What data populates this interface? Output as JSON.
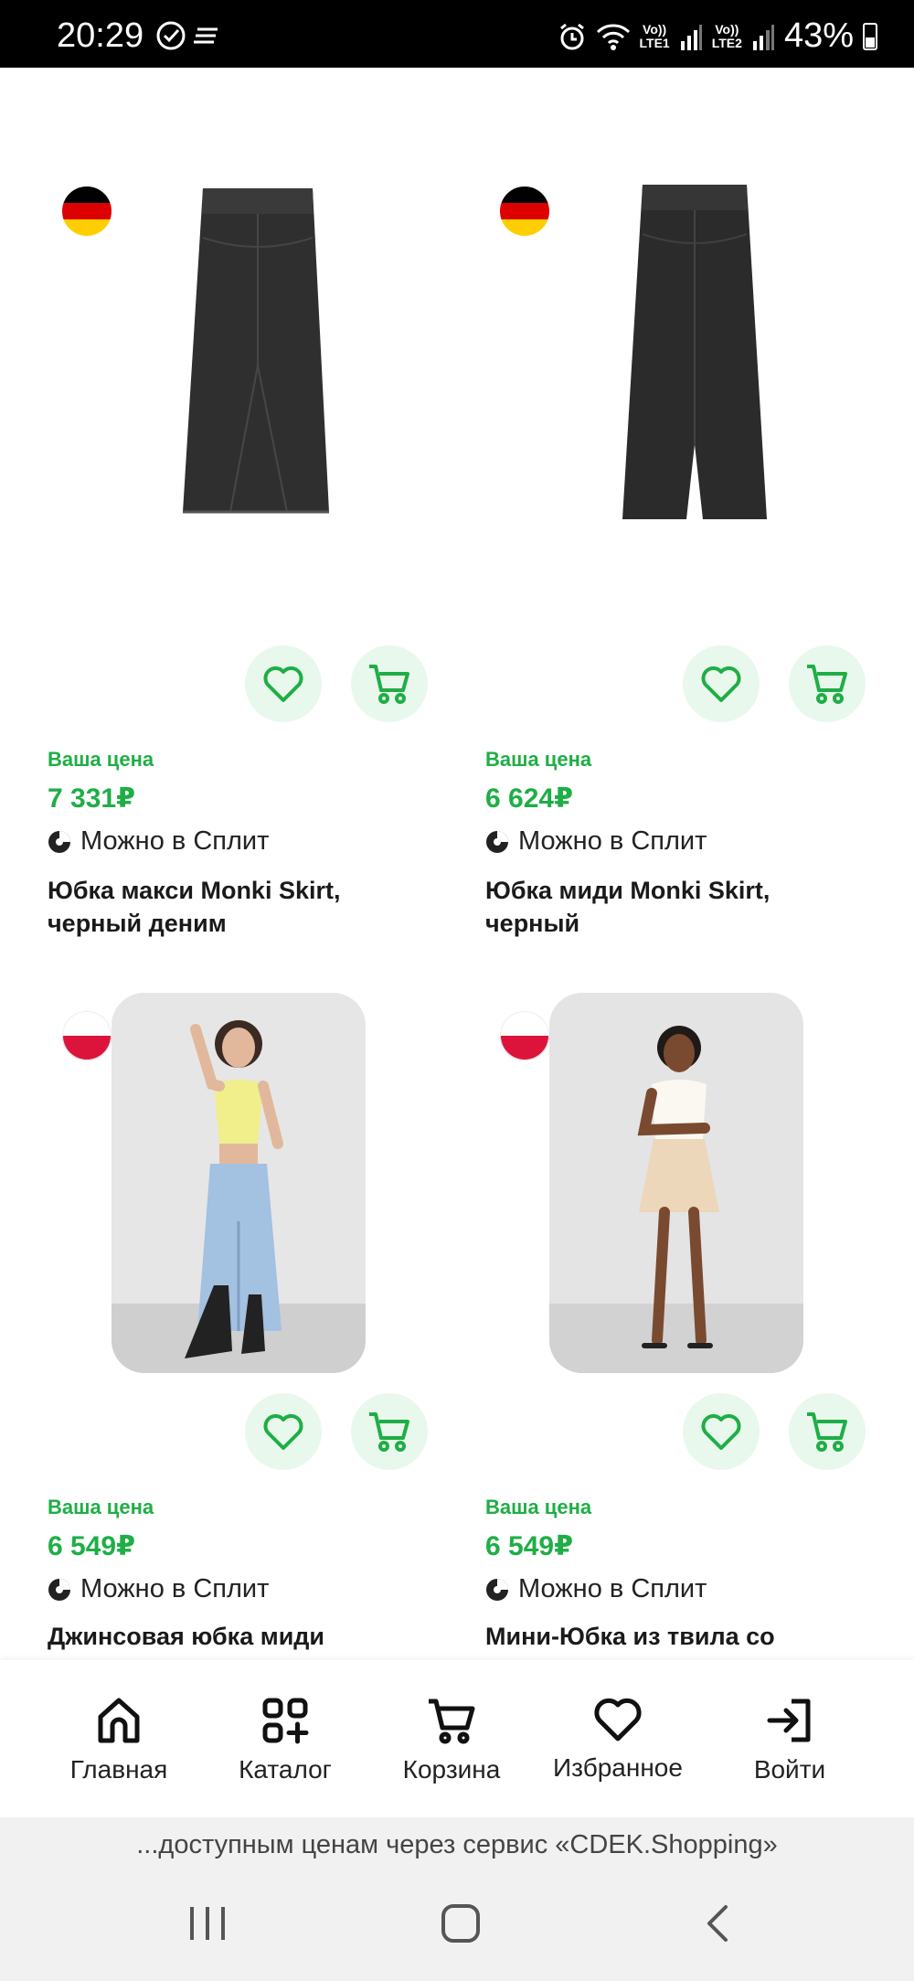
{
  "status_bar": {
    "time": "20:29",
    "battery": "43%",
    "sim1": [
      "Vo))",
      "LTE1"
    ],
    "sim2": [
      "Vo))",
      "LTE2"
    ]
  },
  "products": [
    {
      "flag": "germany",
      "price_caption": "Ваша цена",
      "price": "7 331₽",
      "split": "Можно в Сплит",
      "title": "Юбка макси Monki Skirt, черный деним"
    },
    {
      "flag": "germany",
      "price_caption": "Ваша цена",
      "price": "6 624₽",
      "split": "Можно в Сплит",
      "title": "Юбка миди Monki Skirt, черный"
    },
    {
      "flag": "poland",
      "price_caption": "Ваша цена",
      "price": "6 549₽",
      "split": "Можно в Сплит",
      "title": "Джинсовая юбка миди"
    },
    {
      "flag": "poland",
      "price_caption": "Ваша цена",
      "price": "6 549₽",
      "split": "Можно в Сплит",
      "title": "Мини-Юбка из твила со"
    }
  ],
  "bottom_nav": [
    {
      "label": "Главная",
      "icon": "home-icon"
    },
    {
      "label": "Каталог",
      "icon": "catalog-icon"
    },
    {
      "label": "Корзина",
      "icon": "cart-icon"
    },
    {
      "label": "Избранное",
      "icon": "heart-icon"
    },
    {
      "label": "Войти",
      "icon": "login-icon"
    }
  ],
  "promo": "...доступным ценам через сервис «CDEK.Shopping»",
  "colors": {
    "accent": "#1fae46",
    "action_bg": "#e9f8ec"
  }
}
